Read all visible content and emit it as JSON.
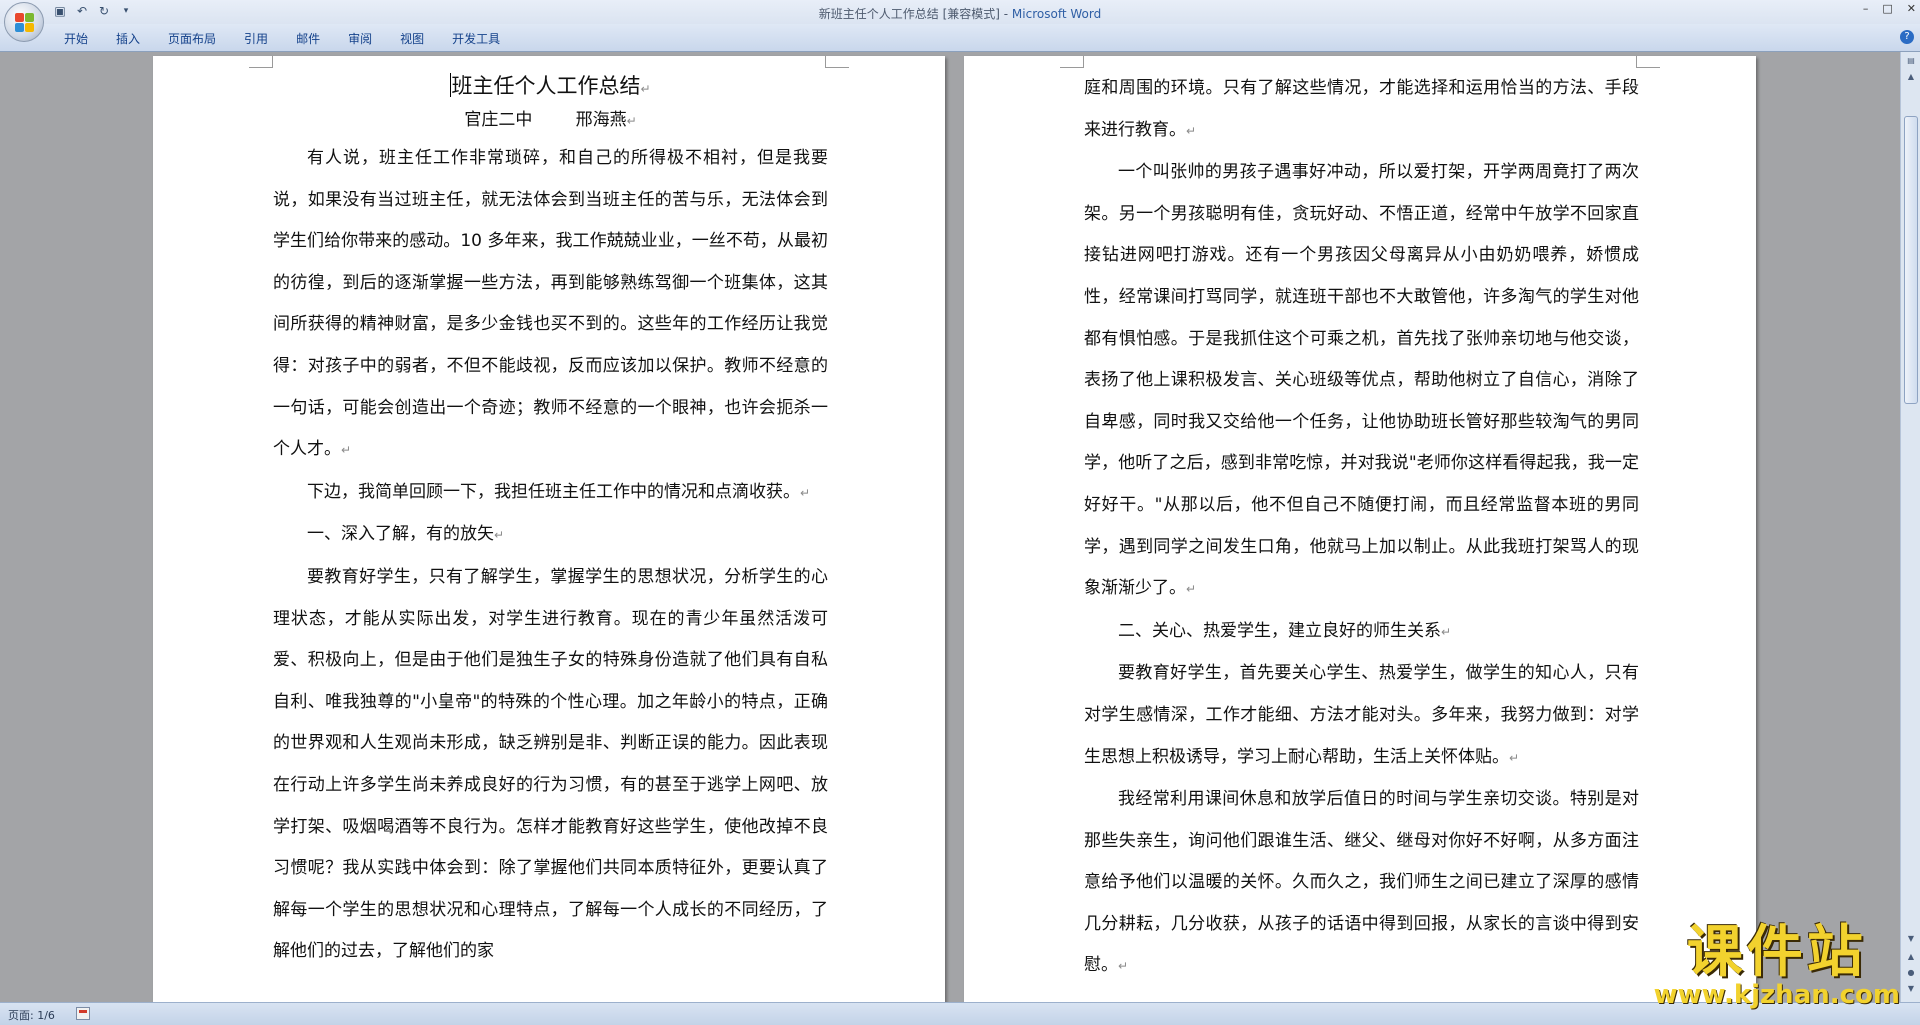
{
  "window": {
    "doc_title": "新班主任个人工作总结 [兼容模式] - ",
    "app_name": "Microsoft Word"
  },
  "quick_access": {
    "icons": [
      "save-icon",
      "undo-icon",
      "redo-icon",
      "customize-icon"
    ]
  },
  "ribbon": {
    "tabs": [
      {
        "label": "开始"
      },
      {
        "label": "插入"
      },
      {
        "label": "页面布局"
      },
      {
        "label": "引用"
      },
      {
        "label": "邮件"
      },
      {
        "label": "审阅"
      },
      {
        "label": "视图"
      },
      {
        "label": "开发工具"
      }
    ]
  },
  "document": {
    "title": "班主任个人工作总结",
    "author": "官庄二中        邢海燕",
    "page1": [
      "有人说，班主任工作非常琐碎，和自己的所得极不相衬，但是我要说，如果没有当过班主任，就无法体会到当班主任的苦与乐，无法体会到学生们给你带来的感动。10 多年来，我工作兢兢业业，一丝不苟，从最初的彷徨，到后的逐渐掌握一些方法，再到能够熟练驾御一个班集体，这其间所获得的精神财富，是多少金钱也买不到的。这些年的工作经历让我觉得：对孩子中的弱者，不但不能歧视，反而应该加以保护。教师不经意的一句话，可能会创造出一个奇迹；教师不经意的一个眼神，也许会扼杀一个人才。",
      "下边，我简单回顾一下，我担任班主任工作中的情况和点滴收获。",
      "一、深入了解，有的放矢",
      "要教育好学生，只有了解学生，掌握学生的思想状况，分析学生的心理状态，才能从实际出发，对学生进行教育。现在的青少年虽然活泼可爱、积极向上，但是由于他们是独生子女的特殊身份造就了他们具有自私自利、唯我独尊的\"小皇帝\"的特殊的个性心理。加之年龄小的特点，正确的世界观和人生观尚未形成，缺乏辨别是非、判断正误的能力。因此表现在行动上许多学生尚未养成良好的行为习惯，有的甚至于逃学上网吧、放学打架、吸烟喝酒等不良行为。怎样才能教育好这些学生，使他改掉不良习惯呢？我从实践中体会到：除了掌握他们共同本质特征外，更要认真了解每一个学生的思想状况和心理特点，了解每一个人成长的不同经历，了解他们的过去，了解他们的家"
    ],
    "page2": [
      "庭和周围的环境。只有了解这些情况，才能选择和运用恰当的方法、手段来进行教育。",
      "一个叫张帅的男孩子遇事好冲动，所以爱打架，开学两周竟打了两次架。另一个男孩聪明有佳，贪玩好动、不悟正道，经常中午放学不回家直接钻进网吧打游戏。还有一个男孩因父母离异从小由奶奶喂养，娇惯成性，经常课间打骂同学，就连班干部也不大敢管他，许多淘气的学生对他都有惧怕感。于是我抓住这个可乘之机，首先找了张帅亲切地与他交谈，表扬了他上课积极发言、关心班级等优点，帮助他树立了自信心，消除了自卑感，同时我又交给他一个任务，让他协助班长管好那些较淘气的男同学，他听了之后，感到非常吃惊，并对我说\"老师你这样看得起我，我一定好好干。\"从那以后，他不但自己不随便打闹，而且经常监督本班的男同学，遇到同学之间发生口角，他就马上加以制止。从此我班打架骂人的现象渐渐少了。",
      "二、关心、热爱学生，建立良好的师生关系",
      "要教育好学生，首先要关心学生、热爱学生，做学生的知心人，只有对学生感情深，工作才能细、方法才能对头。多年来，我努力做到：对学生思想上积极诱导，学习上耐心帮助，生活上关怀体贴。",
      "我经常利用课间休息和放学后值日的时间与学生亲切交谈。特别是对那些失亲生，询问他们跟谁生活、继父、继母对你好不好啊，从多方面注意给予他们以温暖的关怀。久而久之，我们师生之间已建立了深厚的感情几分耕耘，几分收获，从孩子的话语中得到回报，从家长的言谈中得到安慰。"
    ],
    "paragraph_mark": "↵"
  },
  "statusbar": {
    "page_info": "页面: 1/6"
  },
  "watermark": {
    "main": "课件站",
    "sub": "www.kjzhan.com"
  }
}
